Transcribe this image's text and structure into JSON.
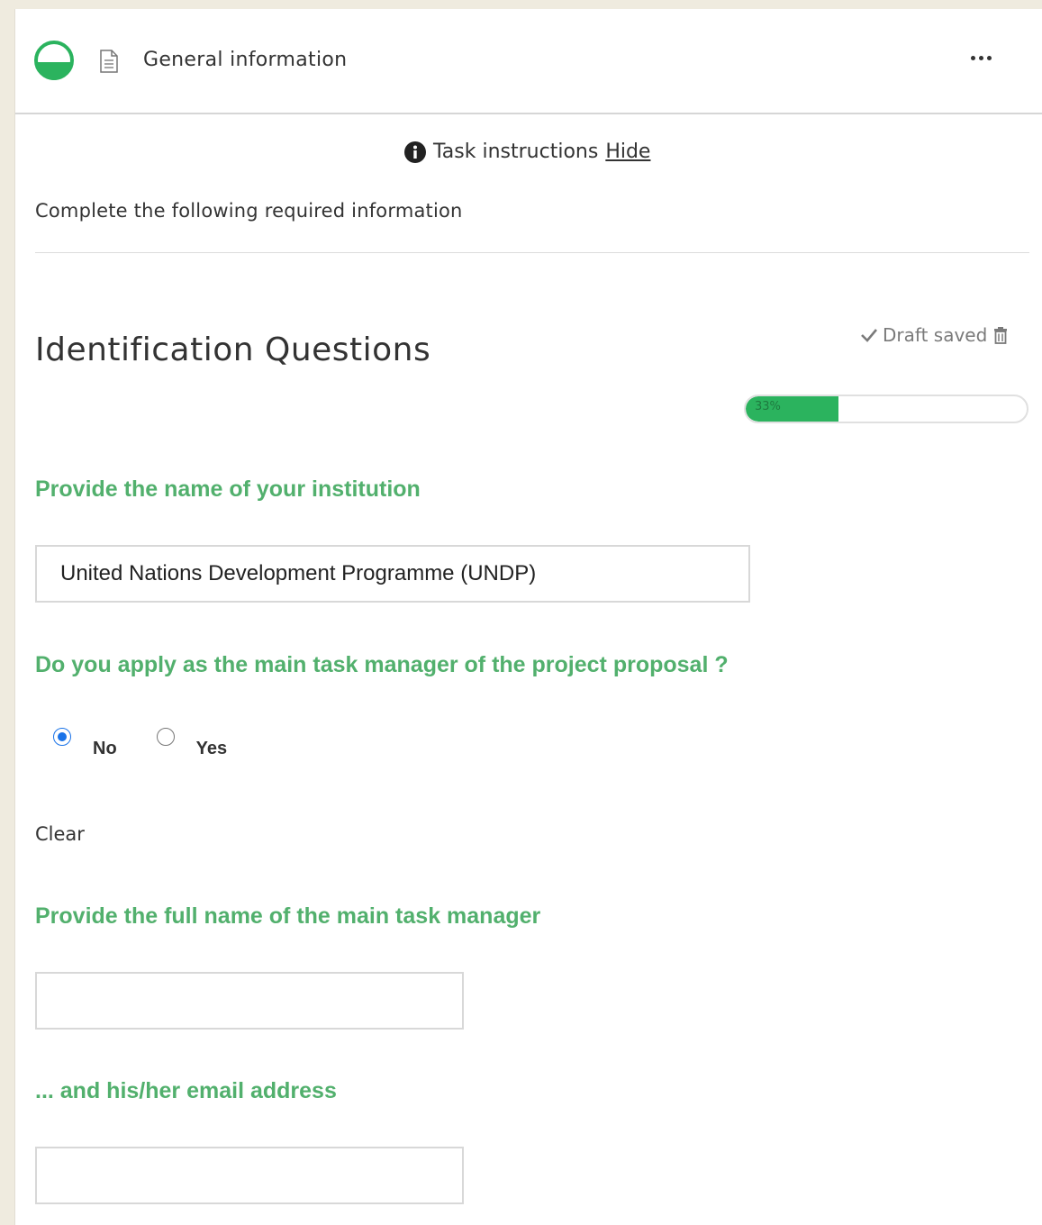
{
  "header": {
    "title": "General information",
    "status_icon": "half-circle-progress-icon",
    "doc_icon": "document-icon",
    "more_icon": "more-dots-icon",
    "accent": "#2bb35e"
  },
  "instructions": {
    "label": "Task instructions",
    "hide_label": "Hide",
    "body": "Complete the following required information"
  },
  "section": {
    "title": "Identification Questions",
    "draft_status": "Draft saved",
    "progress_percent": 33,
    "progress_label": "33%"
  },
  "questions": {
    "institution": {
      "label": "Provide the name of your institution",
      "value": "United Nations Development Programme (UNDP)"
    },
    "main_manager": {
      "label": "Do you apply as the main task manager of the project proposal ?",
      "options": [
        "No",
        "Yes"
      ],
      "selected": "No",
      "clear_label": "Clear"
    },
    "manager_name": {
      "label": "Provide the full name of the main task manager",
      "value": ""
    },
    "manager_email": {
      "label": "... and his/her email address",
      "value": ""
    }
  },
  "colors": {
    "question_green": "#52b06d",
    "radio_blue": "#1a73e8",
    "background": "#efebdf"
  }
}
